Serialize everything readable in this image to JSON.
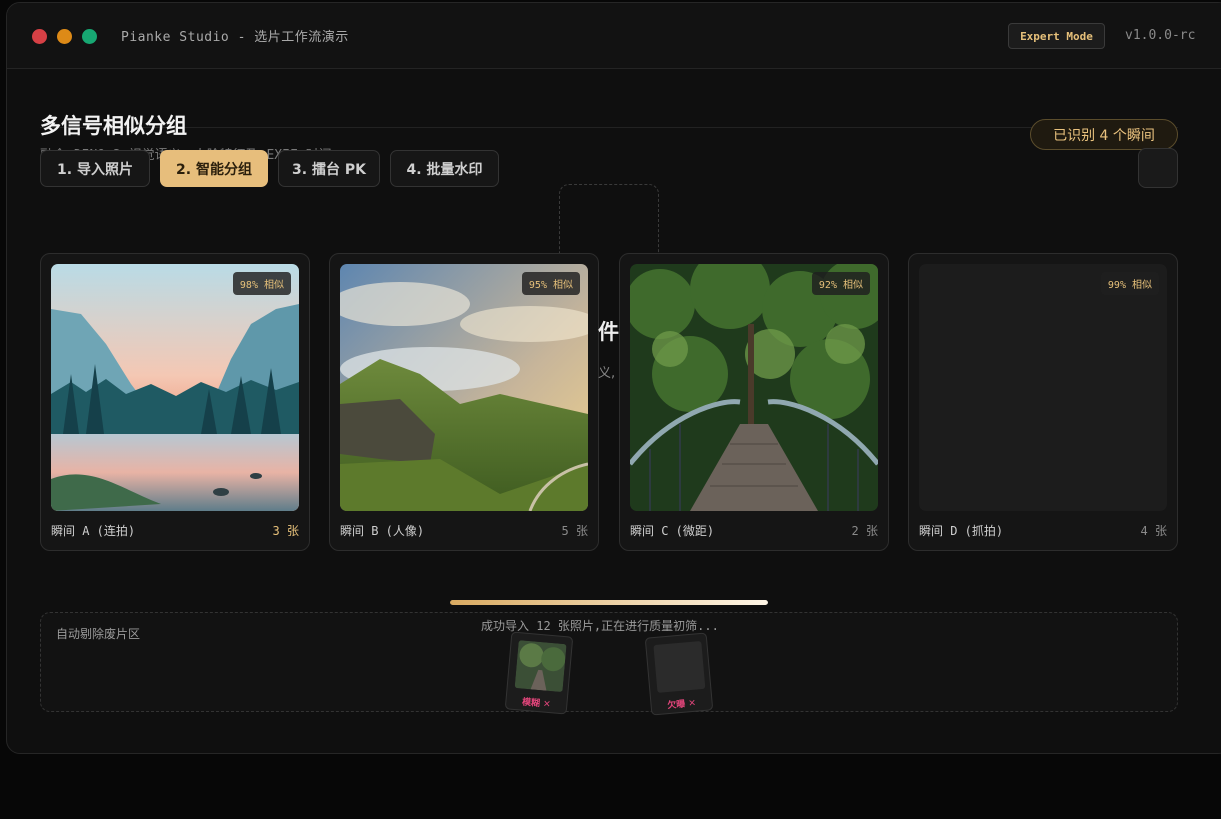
{
  "window": {
    "title": "Pianke Studio - 选片工作流演示",
    "mode_button": "Expert Mode",
    "version": "v1.0.0-rc"
  },
  "header": {
    "title": "多信号相似分组",
    "subtitle": "融合 DINOv2 视觉语义、人脸特征及 EXIF 时间",
    "recognized_badge": "已识别 4 个瞬间"
  },
  "steps": [
    {
      "label": "1. 导入照片",
      "active": false
    },
    {
      "label": "2. 智能分组",
      "active": true
    },
    {
      "label": "3. 擂台 PK",
      "active": false
    },
    {
      "label": "4. 批量水印",
      "active": false
    }
  ],
  "ghost": {
    "big_text": "件",
    "small_text": "义,"
  },
  "moments": [
    {
      "label": "瞬间 A (连拍)",
      "count": "3 张",
      "similarity": "98% 相似",
      "scene": "valley-river"
    },
    {
      "label": "瞬间 B (人像)",
      "count": "5 张",
      "similarity": "95% 相似",
      "scene": "green-mountains"
    },
    {
      "label": "瞬间 C (微距)",
      "count": "2 张",
      "similarity": "92% 相似",
      "scene": "forest-bridge"
    },
    {
      "label": "瞬间 D (抓拍)",
      "count": "4 张",
      "similarity": "99% 相似",
      "scene": "empty"
    }
  ],
  "progress": {
    "fraction": 1.0,
    "status": "成功导入 12 张照片,正在进行质量初筛..."
  },
  "trash": {
    "title": "自动剔除废片区",
    "rejects": [
      {
        "reason": "模糊 ✕"
      },
      {
        "reason": "欠曝 ✕"
      }
    ]
  },
  "colors": {
    "accent": "#e7be7c",
    "reject": "#e0457a"
  }
}
